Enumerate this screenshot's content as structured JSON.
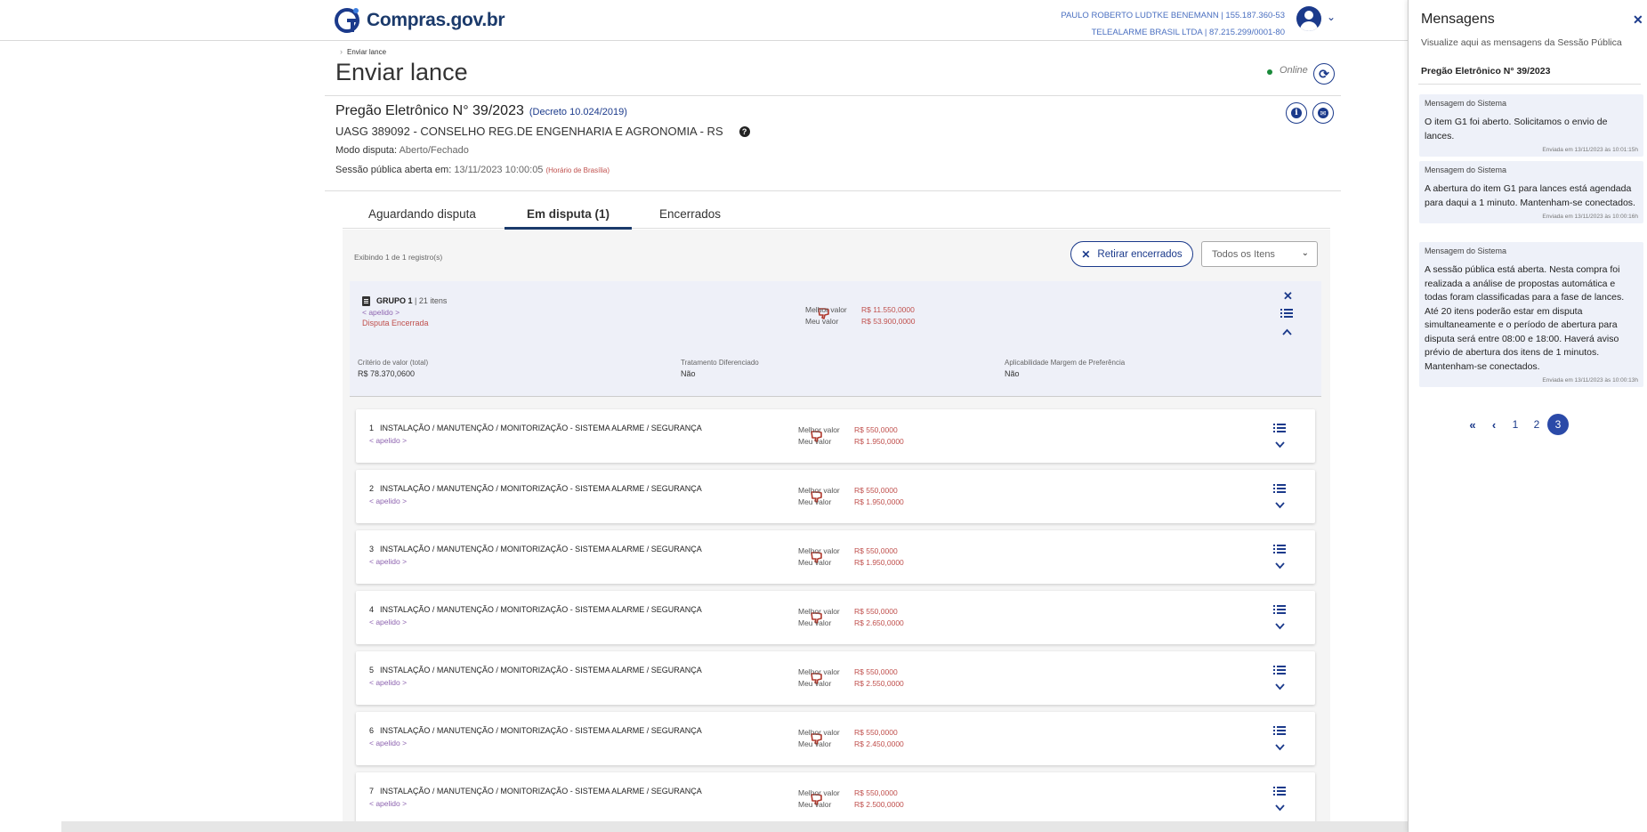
{
  "header": {
    "logo_text": "Compras.gov.br",
    "user_line1": "PAULO ROBERTO LUDTKE BENEMANN | 155.187.360-53",
    "user_line2": "TELEALARME BRASIL LTDA | 87.215.299/0001-80",
    "user_chevron": "⌄"
  },
  "breadcrumb": {
    "current": "Enviar lance"
  },
  "page": {
    "title": "Enviar lance",
    "status": "Online",
    "refresh_icon": "⟳"
  },
  "pregao": {
    "title": "Pregão Eletrônico N° 39/2023",
    "decreto": "(Decreto 10.024/2019)",
    "uasg": "UASG 389092 - CONSELHO REG.DE ENGENHARIA E AGRONOMIA - RS",
    "modo_label": "Modo disputa:",
    "modo_value": "Aberto/Fechado",
    "sessao_label": "Sessão pública aberta em:",
    "sessao_value": "13/11/2023 10:00:05",
    "sessao_tz": "(Horário de Brasília)",
    "help": "?",
    "info": "i",
    "mail": "✉"
  },
  "tabs": [
    {
      "label": "Aguardando disputa"
    },
    {
      "label": "Em disputa (1)"
    },
    {
      "label": "Encerrados"
    }
  ],
  "toolbar": {
    "exibindo": "Exibindo 1 de 1 registro(s)",
    "retirar_label": "Retirar encerrados",
    "retirar_x": "✕",
    "filter_value": "Todos os Itens",
    "filter_chev": "⌄"
  },
  "group": {
    "name": "GRUPO 1",
    "count": "| 21 itens",
    "apelido": "< apelido >",
    "status": "Disputa Encerrada",
    "melhor_label": "Melhor valor",
    "melhor_value": "R$ 11.550,0000",
    "meu_label": "Meu valor",
    "meu_value": "R$ 53.900,0000",
    "close": "✕",
    "up": "⌃",
    "criterio_label": "Critério de valor (total)",
    "criterio_value": "R$ 78.370,0600",
    "tratamento_label": "Tratamento Diferenciado",
    "tratamento_value": "Não",
    "margem_label": "Aplicabilidade Margem de Preferência",
    "margem_value": "Não"
  },
  "items": [
    {
      "n": "1",
      "title": "INSTALAÇÃO / MANUTENÇÃO / MONITORIZAÇÃO - SISTEMA ALARME / SEGURANÇA",
      "apelido": "< apelido >",
      "melhor_label": "Melhor valor",
      "melhor": "R$ 550,0000",
      "meu_label": "Meu valor",
      "meu": "R$ 1.950,0000"
    },
    {
      "n": "2",
      "title": "INSTALAÇÃO / MANUTENÇÃO / MONITORIZAÇÃO - SISTEMA ALARME / SEGURANÇA",
      "apelido": "< apelido >",
      "melhor_label": "Melhor valor",
      "melhor": "R$ 550,0000",
      "meu_label": "Meu valor",
      "meu": "R$ 1.950,0000"
    },
    {
      "n": "3",
      "title": "INSTALAÇÃO / MANUTENÇÃO / MONITORIZAÇÃO - SISTEMA ALARME / SEGURANÇA",
      "apelido": "< apelido >",
      "melhor_label": "Melhor valor",
      "melhor": "R$ 550,0000",
      "meu_label": "Meu valor",
      "meu": "R$ 1.950,0000"
    },
    {
      "n": "4",
      "title": "INSTALAÇÃO / MANUTENÇÃO / MONITORIZAÇÃO - SISTEMA ALARME / SEGURANÇA",
      "apelido": "< apelido >",
      "melhor_label": "Melhor valor",
      "melhor": "R$ 550,0000",
      "meu_label": "Meu valor",
      "meu": "R$ 2.650,0000"
    },
    {
      "n": "5",
      "title": "INSTALAÇÃO / MANUTENÇÃO / MONITORIZAÇÃO - SISTEMA ALARME / SEGURANÇA",
      "apelido": "< apelido >",
      "melhor_label": "Melhor valor",
      "melhor": "R$ 550,0000",
      "meu_label": "Meu valor",
      "meu": "R$ 2.550,0000"
    },
    {
      "n": "6",
      "title": "INSTALAÇÃO / MANUTENÇÃO / MONITORIZAÇÃO - SISTEMA ALARME / SEGURANÇA",
      "apelido": "< apelido >",
      "melhor_label": "Melhor valor",
      "melhor": "R$ 550,0000",
      "meu_label": "Meu valor",
      "meu": "R$ 2.450,0000"
    },
    {
      "n": "7",
      "title": "INSTALAÇÃO / MANUTENÇÃO / MONITORIZAÇÃO - SISTEMA ALARME / SEGURANÇA",
      "apelido": "< apelido >",
      "melhor_label": "Melhor valor",
      "melhor": "R$ 550,0000",
      "meu_label": "Meu valor",
      "meu": "R$ 2.500,0000"
    }
  ],
  "item_down": "⌄",
  "thumb": "👎",
  "messages_panel": {
    "title": "Mensagens",
    "close": "✕",
    "subtitle": "Visualize aqui as mensagens da Sessão Pública",
    "pregao": "Pregão Eletrônico N° 39/2023",
    "messages": [
      {
        "head": "Mensagem do Sistema",
        "body": "O item G1 foi aberto. Solicitamos o envio de lances.",
        "time": "Enviada em 13/11/2023 às 10:01:15h"
      },
      {
        "head": "Mensagem do Sistema",
        "body": "A abertura do item G1 para lances está agendada para daqui a 1 minuto. Mantenham-se conectados.",
        "time": "Enviada em 13/11/2023 às 10:00:16h"
      },
      {
        "head": "Mensagem do Sistema",
        "body": "A sessão pública está aberta. Nesta compra foi realizada a análise de propostas automática e todas foram classificadas para a fase de lances. Até 20 itens poderão estar em disputa simultaneamente e o período de abertura para disputa será entre 08:00 e 18:00. Haverá aviso prévio de abertura dos itens de 1 minutos. Mantenham-se conectados.",
        "time": "Enviada em 13/11/2023 às 10:00:13h"
      }
    ],
    "pager": {
      "first": "«",
      "prev": "‹",
      "pages": [
        "1",
        "2",
        "3"
      ],
      "current": "3"
    }
  },
  "colors": {
    "brand": "#1b3a8b",
    "accent_red": "#c0504d",
    "apelido": "#8e64b0"
  }
}
